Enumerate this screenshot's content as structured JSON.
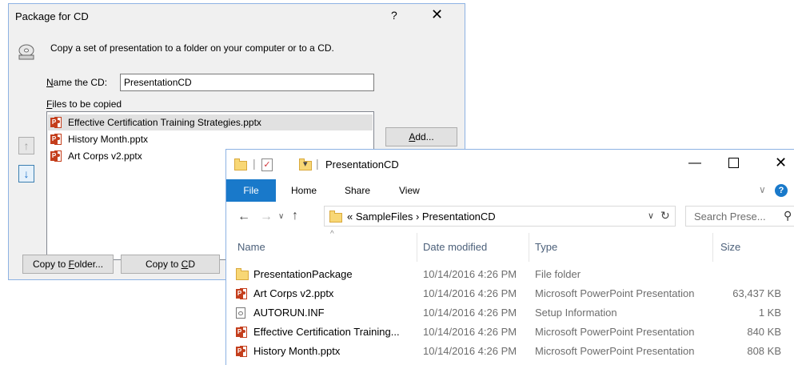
{
  "dialog": {
    "title": "Package for CD",
    "help_glyph": "?",
    "close_glyph": "✕",
    "description": "Copy a set of presentation to a folder on your computer or to a CD.",
    "name_label_prefix": "N",
    "name_label_rest": "ame the CD:",
    "name_value": "PresentationCD",
    "files_label_prefix": "F",
    "files_label_rest": "iles to be copied",
    "files": [
      {
        "name": "Effective Certification Training Strategies.pptx",
        "selected": true
      },
      {
        "name": "History Month.pptx",
        "selected": false
      },
      {
        "name": "Art Corps v2.pptx",
        "selected": false
      }
    ],
    "up_glyph": "↑",
    "down_glyph": "↓",
    "add_prefix": "A",
    "add_rest": "dd...",
    "copy_folder_a": "Copy to ",
    "copy_folder_u": "F",
    "copy_folder_b": "older...",
    "copy_cd_a": "Copy to ",
    "copy_cd_u": "C",
    "copy_cd_b": "D"
  },
  "explorer": {
    "title": "PresentationCD",
    "qa_sep": "|",
    "qa_check": "✓",
    "qa_dropdown": "▾",
    "min_glyph": "—",
    "close_glyph": "✕",
    "ribbon": {
      "file": "File",
      "home": "Home",
      "share": "Share",
      "view": "View",
      "chevron": "∨",
      "help": "?"
    },
    "nav": {
      "back": "←",
      "forward": "→",
      "recent": "∨",
      "up": "↑"
    },
    "address": {
      "text": "« SampleFiles  ›  PresentationCD",
      "dropdown": "∨",
      "refresh": "↻"
    },
    "search": {
      "placeholder": "Search Prese...",
      "icon": "⚲"
    },
    "sort_caret": "^",
    "columns": {
      "name": "Name",
      "date": "Date modified",
      "type": "Type",
      "size": "Size"
    },
    "rows": [
      {
        "name": "PresentationPackage",
        "date": "10/14/2016 4:26 PM",
        "type": "File folder",
        "size": "",
        "icon": "folder-icon"
      },
      {
        "name": "Art Corps v2.pptx",
        "date": "10/14/2016 4:26 PM",
        "type": "Microsoft PowerPoint Presentation",
        "size": "63,437 KB",
        "icon": "powerpoint-icon"
      },
      {
        "name": "AUTORUN.INF",
        "date": "10/14/2016 4:26 PM",
        "type": "Setup Information",
        "size": "1 KB",
        "icon": "setup-file-icon"
      },
      {
        "name": "Effective Certification Training...",
        "date": "10/14/2016 4:26 PM",
        "type": "Microsoft PowerPoint Presentation",
        "size": "840 KB",
        "icon": "powerpoint-icon"
      },
      {
        "name": "History Month.pptx",
        "date": "10/14/2016 4:26 PM",
        "type": "Microsoft PowerPoint Presentation",
        "size": "808 KB",
        "icon": "powerpoint-icon"
      }
    ]
  }
}
